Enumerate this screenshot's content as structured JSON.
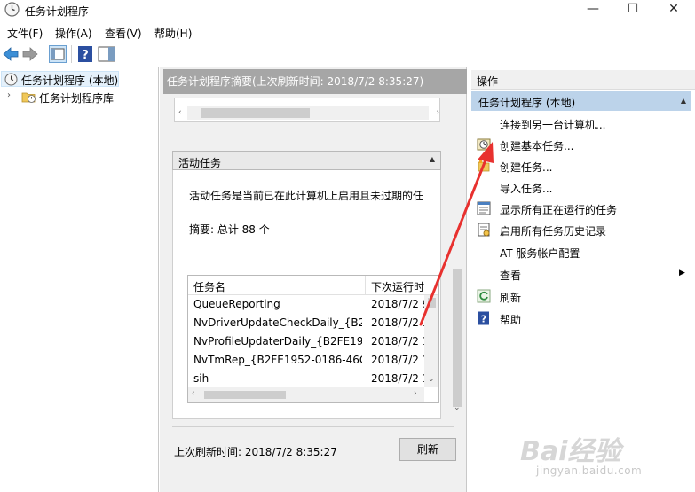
{
  "window": {
    "title": "任务计划程序",
    "minimize": "—",
    "maximize": "☐",
    "close": "✕"
  },
  "menu": [
    "文件(F)",
    "操作(A)",
    "查看(V)",
    "帮助(H)"
  ],
  "tree": {
    "root": "任务计划程序 (本地)",
    "child": "任务计划程序库"
  },
  "middle": {
    "header": "任务计划程序摘要(上次刷新时间: 2018/7/2 8:35:27)",
    "section_title": "活动任务",
    "description": "活动任务是当前已在此计算机上启用且未过期的任",
    "summary": "摘要: 总计 88 个",
    "columns": [
      "任务名",
      "下次运行时"
    ],
    "rows": [
      {
        "name": "QueueReporting",
        "next": "2018/7/2 9"
      },
      {
        "name": "NvDriverUpdateCheckDaily_{B2...",
        "next": "2018/7/2 1"
      },
      {
        "name": "NvProfileUpdaterDaily_{B2FE19...",
        "next": "2018/7/2 1"
      },
      {
        "name": "NvTmRep_{B2FE1952-0186-46C...",
        "next": "2018/7/2 1"
      },
      {
        "name": "sih",
        "next": "2018/7/2 1"
      }
    ],
    "last_refresh": "上次刷新时间: 2018/7/2 8:35:27",
    "refresh_button": "刷新"
  },
  "actions": {
    "header": "操作",
    "group": "任务计划程序 (本地)",
    "items": [
      {
        "label": "连接到另一台计算机...",
        "icon": "none"
      },
      {
        "label": "创建基本任务...",
        "icon": "create-basic-task-icon"
      },
      {
        "label": "创建任务...",
        "icon": "create-task-icon"
      },
      {
        "label": "导入任务...",
        "icon": "none"
      },
      {
        "label": "显示所有正在运行的任务",
        "icon": "running-tasks-icon"
      },
      {
        "label": "启用所有任务历史记录",
        "icon": "history-icon"
      },
      {
        "label": "AT 服务帐户配置",
        "icon": "none"
      },
      {
        "label": "查看",
        "icon": "none"
      },
      {
        "label": "刷新",
        "icon": "refresh-icon"
      },
      {
        "label": "帮助",
        "icon": "help-icon"
      }
    ]
  },
  "watermark": {
    "logo": "Bai经验",
    "url": "jingyan.baidu.com"
  },
  "colors": {
    "header_gray": "#a6a6a6",
    "group_blue": "#bcd3ea",
    "arrow_red": "#e8312f"
  }
}
